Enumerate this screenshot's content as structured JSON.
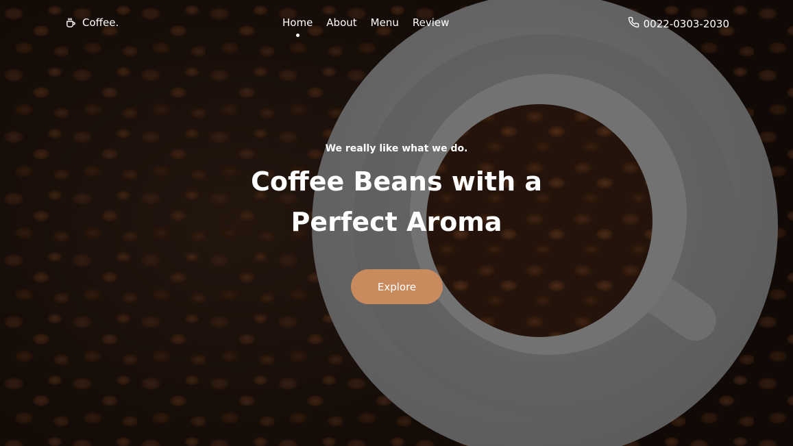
{
  "brand": {
    "name": "Coffee.",
    "icon": "coffee-cup-icon"
  },
  "nav": {
    "items": [
      {
        "label": "Home",
        "active": true
      },
      {
        "label": "About"
      },
      {
        "label": "Menu"
      },
      {
        "label": "Review"
      }
    ]
  },
  "contact": {
    "phone": "0022-0303-2030",
    "icon": "phone-icon"
  },
  "hero": {
    "tagline": "We really like what we do.",
    "headline_line1": "Coffee Beans with a",
    "headline_line2": "Perfect Aroma",
    "cta_label": "Explore"
  },
  "colors": {
    "accent": "#c98a5d",
    "text": "#ffffff"
  }
}
